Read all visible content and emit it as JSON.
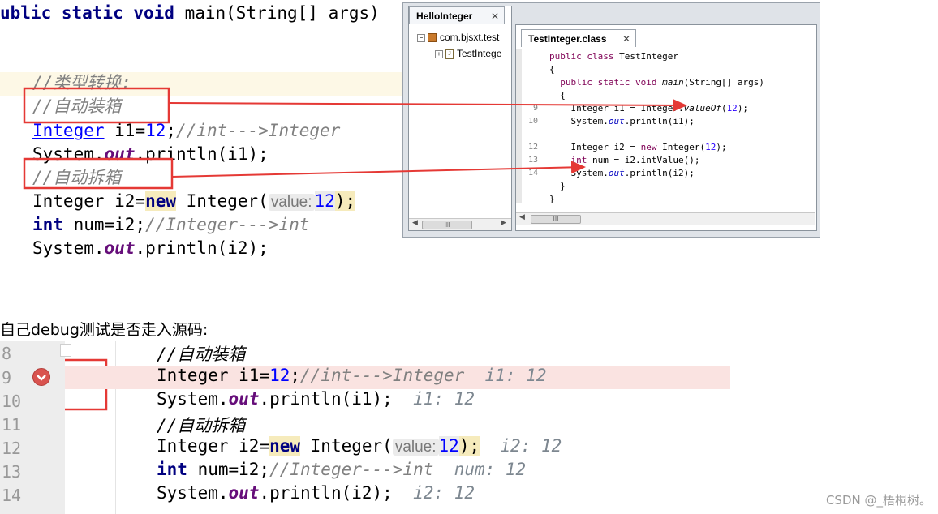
{
  "top_code": {
    "line1": {
      "kw": "ublic static void",
      "rest": " main(String[] args)"
    },
    "line2": "//类型转换:",
    "line3": "//自动装箱",
    "line4": {
      "type": "Integer",
      "decl": " i1=",
      "num": "12",
      "semi": ";",
      "comment": "//int--->Integer"
    },
    "line5": {
      "a": "System.",
      "field": "out",
      "b": ".println(i1);"
    },
    "line6": "//自动拆箱",
    "line7": {
      "a": "Integer i2=",
      "kw": "new",
      "b": " Integer(",
      "hint": "value:",
      "num": "12",
      "c": ");"
    },
    "line8": {
      "kw": "int",
      "a": " num=i2;",
      "comment": "//Integer--->int"
    },
    "line9": {
      "a": "System.",
      "field": "out",
      "b": ".println(i2);"
    }
  },
  "eclipse": {
    "left_tab": "HelloInteger",
    "tab_close": "✕",
    "tree_pkg": "com.bjsxt.test",
    "tree_file": "TestIntege",
    "right_tab": "TestInteger.class",
    "scroll_thumb": "III",
    "lines": [
      {
        "num": "",
        "code": "public class TestInteger"
      },
      {
        "num": "",
        "code": "{"
      },
      {
        "num": "",
        "code": "  public static void main(String[] args)"
      },
      {
        "num": "",
        "code": "  {"
      },
      {
        "num": "9",
        "code": "    Integer i1 = Integer.valueOf(12);"
      },
      {
        "num": "10",
        "code": "    System.out.println(i1);"
      },
      {
        "num": "",
        "code": ""
      },
      {
        "num": "12",
        "code": "    Integer i2 = new Integer(12);"
      },
      {
        "num": "13",
        "code": "    int num = i2.intValue();"
      },
      {
        "num": "14",
        "code": "    System.out.println(i2);"
      },
      {
        "num": "",
        "code": "  }"
      },
      {
        "num": "",
        "code": "}"
      }
    ]
  },
  "caption": "自己debug测试是否走入源码:",
  "bottom": {
    "lines": [
      {
        "num": "8"
      },
      {
        "num": "9"
      },
      {
        "num": "10"
      },
      {
        "num": "11"
      },
      {
        "num": "12"
      },
      {
        "num": "13"
      },
      {
        "num": "14"
      }
    ],
    "c8": "//自动装箱",
    "c9": {
      "a": "Integer i1=",
      "num": "12",
      "b": ";",
      "comment": "//int--->Integer",
      "dbg": "i1: 12"
    },
    "c10": {
      "a": "System.",
      "field": "out",
      "b": ".println(i1);",
      "dbg": "i1: 12"
    },
    "c11": "//自动拆箱",
    "c12": {
      "a": "Integer i2=",
      "kw": "new",
      "b": " Integer(",
      "hint": "value:",
      "num": "12",
      "c": ");",
      "dbg": "i2: 12"
    },
    "c13": {
      "kw": "int",
      "a": " num=i2;",
      "comment": "//Integer--->int",
      "dbg": "num: 12"
    },
    "c14": {
      "a": "System.",
      "field": "out",
      "b": ".println(i2);",
      "dbg": "i2: 12"
    }
  },
  "watermark": "CSDN @_梧桐树。",
  "colors": {
    "annotation_red": "#e53935",
    "exec_line": "#fae3e1",
    "keyword": "#000080",
    "comment": "#808080"
  }
}
